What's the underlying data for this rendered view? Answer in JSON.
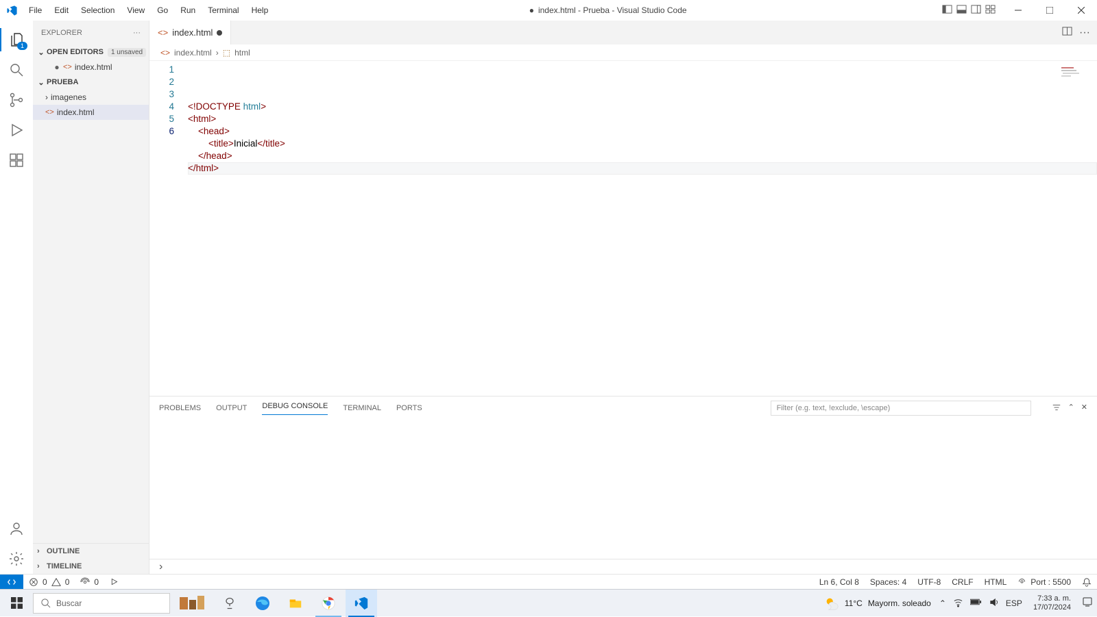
{
  "titlebar": {
    "menu": [
      "File",
      "Edit",
      "Selection",
      "View",
      "Go",
      "Run",
      "Terminal",
      "Help"
    ],
    "title_filename": "index.html",
    "title_project": "Prueba",
    "title_app": "Visual Studio Code",
    "modified_indicator": "●"
  },
  "activitybar": {
    "explorer_badge": "1"
  },
  "sidebar": {
    "title": "Explorer",
    "open_editors_label": "Open Editors",
    "unsaved_badge": "1 unsaved",
    "open_editor_item": "index.html",
    "project_label": "Prueba",
    "folder_item": "imagenes",
    "file_item": "index.html",
    "outline_label": "Outline",
    "timeline_label": "Timeline"
  },
  "tab": {
    "label": "index.html"
  },
  "breadcrumb": {
    "file": "index.html",
    "tag": "html"
  },
  "code": {
    "lines": [
      {
        "n": "1",
        "html": "<span class='pn'>&lt;!</span><span class='tg'>DOCTYPE</span> <span class='an'>html</span><span class='pn'>&gt;</span>"
      },
      {
        "n": "2",
        "html": "<span class='pn'>&lt;</span><span class='tg'>html</span><span class='pn'>&gt;</span>"
      },
      {
        "n": "3",
        "html": "    <span class='pn'>&lt;</span><span class='tg'>head</span><span class='pn'>&gt;</span>"
      },
      {
        "n": "4",
        "html": "        <span class='pn'>&lt;</span><span class='tg'>title</span><span class='pn'>&gt;</span><span class='txt'>Inicial</span><span class='pn'>&lt;/</span><span class='tg'>title</span><span class='pn'>&gt;</span>"
      },
      {
        "n": "5",
        "html": "    <span class='pn'>&lt;/</span><span class='tg'>head</span><span class='pn'>&gt;</span>"
      },
      {
        "n": "6",
        "html": "<span class='pn'>&lt;/</span><span class='tg'>html</span><span class='pn'>&gt;</span>"
      }
    ],
    "current_line": 6
  },
  "panel": {
    "tabs": [
      "PROBLEMS",
      "OUTPUT",
      "DEBUG CONSOLE",
      "TERMINAL",
      "PORTS"
    ],
    "active_tab": "DEBUG CONSOLE",
    "filter_placeholder": "Filter (e.g. text, !exclude, \\escape)"
  },
  "statusbar": {
    "errors": "0",
    "warnings": "0",
    "ports": "0",
    "ln_col": "Ln 6, Col 8",
    "spaces": "Spaces: 4",
    "encoding": "UTF-8",
    "eol": "CRLF",
    "lang": "HTML",
    "live": "Port : 5500"
  },
  "taskbar": {
    "search_placeholder": "Buscar",
    "weather_temp": "11°C",
    "weather_desc": "Mayorm. soleado",
    "ime": "ESP",
    "time": "7:33 a. m.",
    "date": "17/07/2024"
  }
}
